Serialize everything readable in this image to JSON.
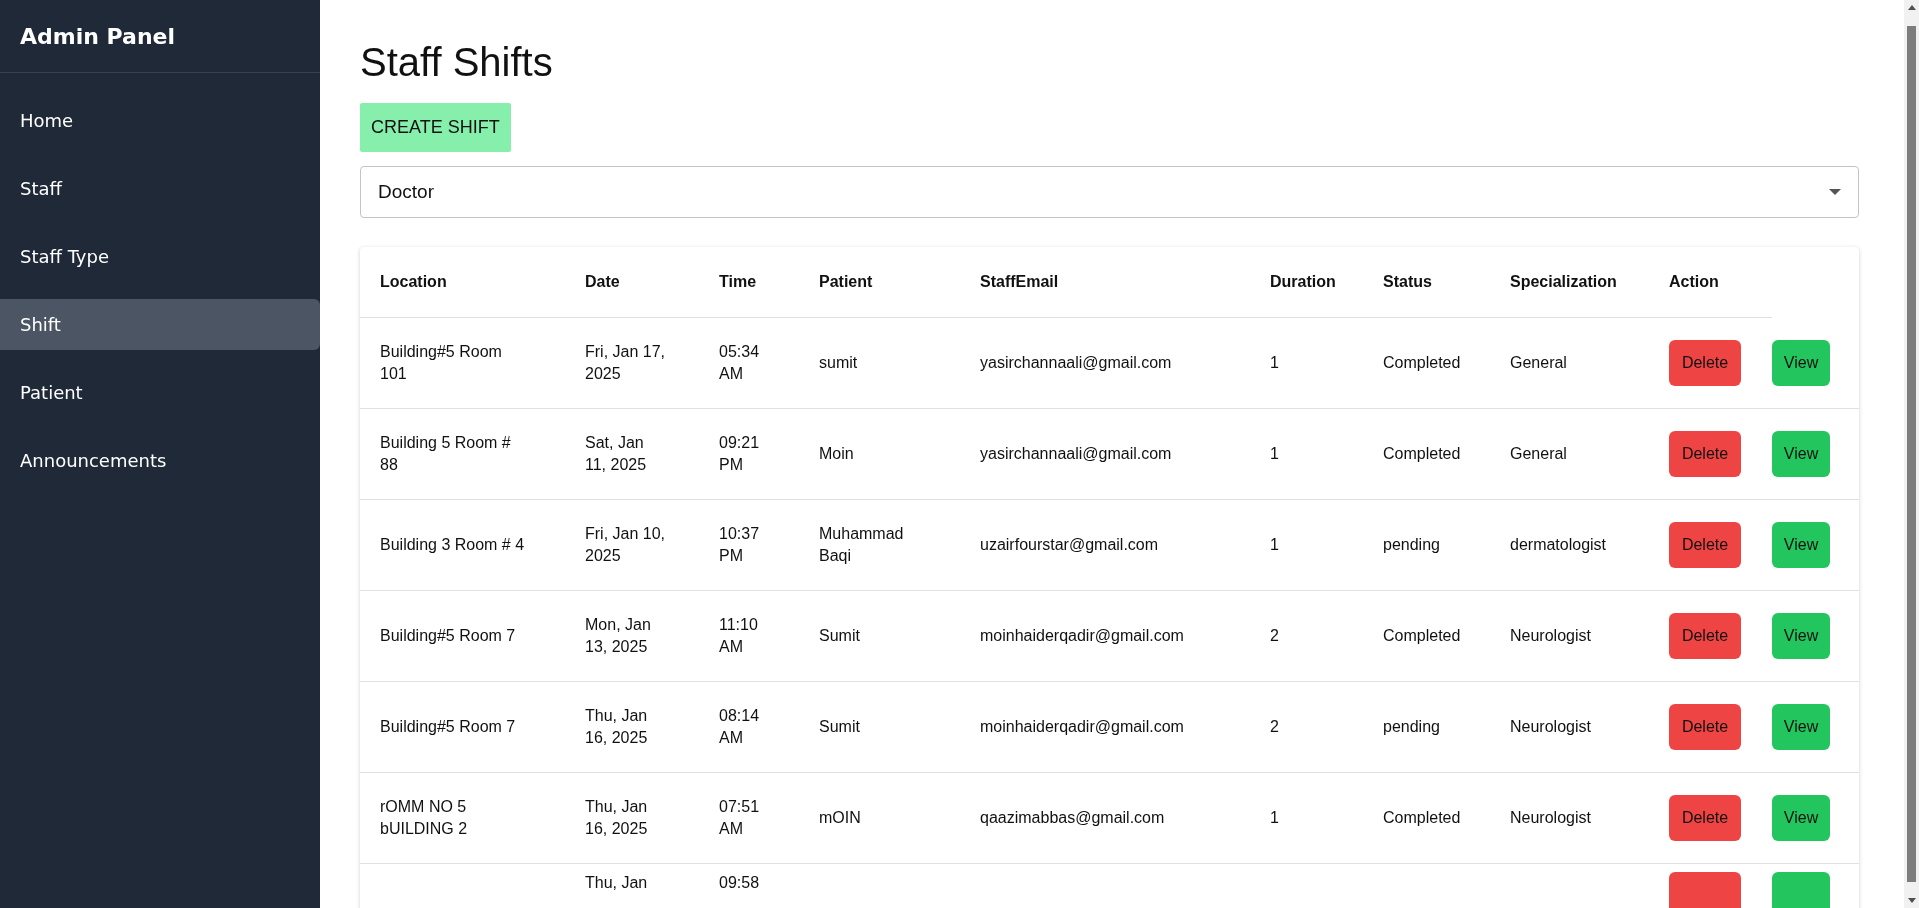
{
  "sidebar": {
    "title": "Admin Panel",
    "items": [
      {
        "label": "Home",
        "selected": false
      },
      {
        "label": "Staff",
        "selected": false
      },
      {
        "label": "Staff Type",
        "selected": false
      },
      {
        "label": "Shift",
        "selected": true
      },
      {
        "label": "Patient",
        "selected": false
      },
      {
        "label": "Announcements",
        "selected": false
      }
    ]
  },
  "page": {
    "title": "Staff Shifts",
    "create_button": "CREATE SHIFT",
    "staff_type_select": {
      "value": "Doctor"
    }
  },
  "table": {
    "columns": [
      "Location",
      "Date",
      "Time",
      "Patient",
      "StaffEmail",
      "Duration",
      "Status",
      "Specialization",
      "Action"
    ],
    "rows": [
      {
        "cells": [
          "Building#5 Room 101",
          "Fri, Jan 17, 2025",
          "05:34 AM",
          "sumit",
          "yasirchannaali@gmail.com",
          "1",
          "Completed",
          "General"
        ],
        "actions": [
          {
            "kind": "delete",
            "label": "Delete"
          },
          {
            "kind": "view",
            "label": "View"
          }
        ]
      },
      {
        "cells": [
          "Building 5 Room # 88",
          "Sat, Jan 11, 2025",
          "09:21 PM",
          "Moin",
          "yasirchannaali@gmail.com",
          "1",
          "Completed",
          "General"
        ],
        "actions": [
          {
            "kind": "delete",
            "label": "Delete"
          },
          {
            "kind": "view",
            "label": "View"
          }
        ]
      },
      {
        "cells": [
          "Building 3 Room # 4",
          "Fri, Jan 10, 2025",
          "10:37 PM",
          "Muhammad Baqi",
          "uzairfourstar@gmail.com",
          "1",
          "pending",
          "dermatologist"
        ],
        "actions": [
          {
            "kind": "delete",
            "label": "Delete"
          },
          {
            "kind": "view",
            "label": "View"
          }
        ]
      },
      {
        "cells": [
          "Building#5 Room 7",
          "Mon, Jan 13, 2025",
          "11:10 AM",
          "Sumit",
          "moinhaiderqadir@gmail.com",
          "2",
          "Completed",
          "Neurologist"
        ],
        "actions": [
          {
            "kind": "delete",
            "label": "Delete"
          },
          {
            "kind": "view",
            "label": "View"
          }
        ]
      },
      {
        "cells": [
          "Building#5 Room 7",
          "Thu, Jan 16, 2025",
          "08:14 AM",
          "Sumit",
          "moinhaiderqadir@gmail.com",
          "2",
          "pending",
          "Neurologist"
        ],
        "actions": [
          {
            "kind": "delete",
            "label": "Delete"
          },
          {
            "kind": "view",
            "label": "View"
          }
        ]
      },
      {
        "cells": [
          "rOMM NO 5 bUILDING 2",
          "Thu, Jan 16, 2025",
          "07:51 AM",
          "mOIN",
          "qaazimabbas@gmail.com",
          "1",
          "Completed",
          "Neurologist"
        ],
        "actions": [
          {
            "kind": "delete",
            "label": "Delete"
          },
          {
            "kind": "view",
            "label": "View"
          }
        ]
      },
      {
        "partial": true,
        "cells": [
          "",
          "Thu, Jan",
          "09:58",
          "",
          "",
          "",
          "",
          ""
        ],
        "actions": [
          {
            "kind": "delete"
          },
          {
            "kind": "view"
          }
        ]
      }
    ]
  }
}
